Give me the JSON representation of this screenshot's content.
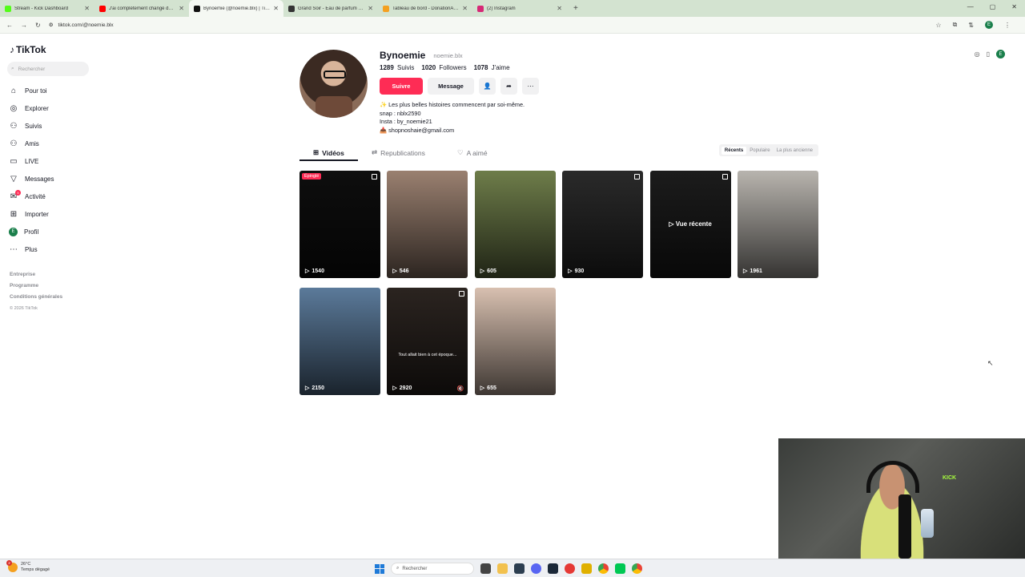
{
  "browser": {
    "tabs": [
      {
        "title": "Stream - Kick Dashboard",
        "color": "#53fc18"
      },
      {
        "title": "J'ai complètement changé de ...",
        "color": "#ff0000"
      },
      {
        "title": "Bynoemie (@noemie.blx) | TikTok",
        "color": "#111111",
        "active": true
      },
      {
        "title": "Grand Soir - Eau de parfum - ...",
        "color": "#333333"
      },
      {
        "title": "Tableau de bord - DonationAle...",
        "color": "#f4a020"
      },
      {
        "title": "(2) Instagram",
        "color": "#d62976"
      }
    ],
    "url": "tiktok.com/@noemie.blx",
    "account_initial": "E"
  },
  "sidebar": {
    "logo": "TikTok",
    "search_placeholder": "Rechercher",
    "items": [
      {
        "label": "Pour toi",
        "icon": "home-icon"
      },
      {
        "label": "Explorer",
        "icon": "compass-icon"
      },
      {
        "label": "Suivis",
        "icon": "following-icon"
      },
      {
        "label": "Amis",
        "icon": "friends-icon"
      },
      {
        "label": "LIVE",
        "icon": "live-icon"
      },
      {
        "label": "Messages",
        "icon": "messages-icon"
      },
      {
        "label": "Activité",
        "icon": "activity-icon",
        "badge": "5"
      },
      {
        "label": "Importer",
        "icon": "upload-icon"
      },
      {
        "label": "Profil",
        "icon": "profile-icon"
      },
      {
        "label": "Plus",
        "icon": "more-icon"
      }
    ],
    "footer": [
      "Entreprise",
      "Programme",
      "Conditions générales"
    ],
    "copyright": "© 2026 TikTok"
  },
  "profile": {
    "name": "Bynoemie",
    "username": "noemie.blx",
    "following_count": "1289",
    "following_label": "Suivis",
    "followers_count": "1020",
    "followers_label": "Followers",
    "likes_count": "1078",
    "likes_label": "J'aime",
    "follow_label": "Suivre",
    "message_label": "Message",
    "bio": [
      "✨ Les plus belles histoires commencent par soi-même.",
      "snap : nblx2590",
      "Insta : by_noemie21",
      "📥 shopnoshaie@gmail.com"
    ]
  },
  "tabs": {
    "videos": "Vidéos",
    "reposts": "Republications",
    "liked": "A aimé",
    "sort": [
      "Récents",
      "Populaire",
      "La plus ancienne"
    ],
    "sort_selected": "Récents"
  },
  "videos": [
    {
      "views": "1540",
      "pinned": "Épinglé",
      "bg": "#0e0e0e",
      "multi": true
    },
    {
      "views": "546",
      "bg": "#9a8070"
    },
    {
      "views": "605",
      "bg": "#6e7d4a"
    },
    {
      "views": "930",
      "bg": "#2a2a2a",
      "multi": true
    },
    {
      "views": "",
      "bg": "#1c1c1c",
      "recent": "Vue récente",
      "multi": true
    },
    {
      "views": "1961",
      "bg": "#b8b4ae"
    },
    {
      "views": "2150",
      "bg": "#5b7a9a"
    },
    {
      "views": "2920",
      "bg": "#2b2420",
      "caption": "Tout allait bien à cet époque...",
      "multi": true,
      "muted": true
    },
    {
      "views": "655",
      "bg": "#d8c0b0"
    }
  ],
  "taskbar": {
    "temperature": "26°C",
    "weather": "Temps dégagé",
    "weather_badge": "2",
    "search": "Rechercher"
  },
  "webcam": {
    "sign": "KICK"
  }
}
